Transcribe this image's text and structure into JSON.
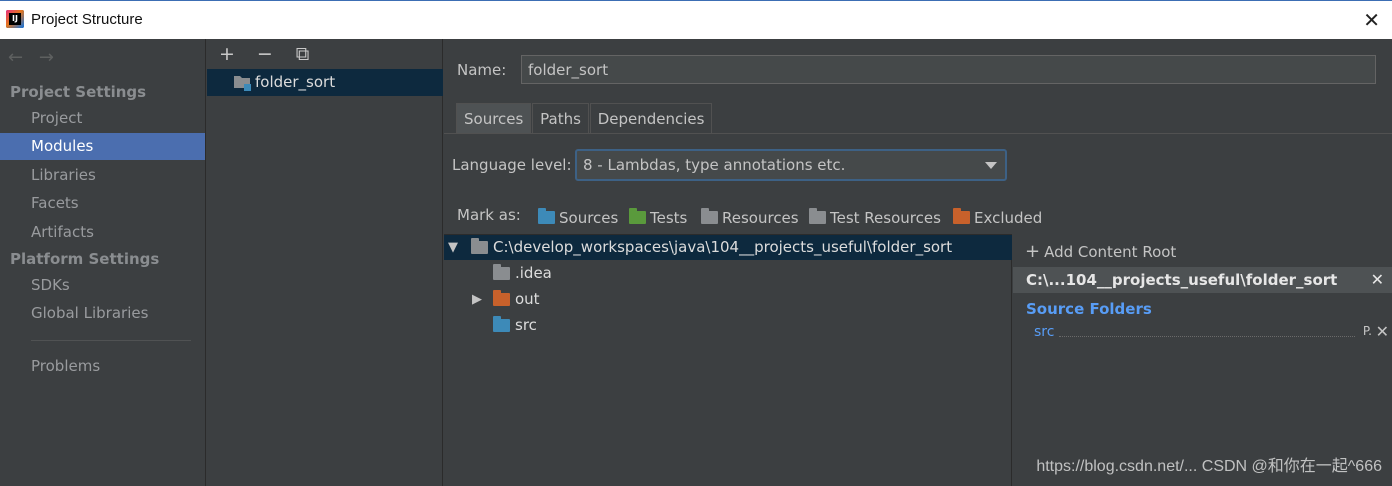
{
  "window": {
    "title": "Project Structure",
    "close_glyph": "✕"
  },
  "nav": {
    "back_glyph": "←",
    "forward_glyph": "→",
    "project_settings_header": "Project Settings",
    "project_settings_items": [
      "Project",
      "Modules",
      "Libraries",
      "Facets",
      "Artifacts"
    ],
    "selected": "Modules",
    "platform_settings_header": "Platform Settings",
    "platform_settings_items": [
      "SDKs",
      "Global Libraries"
    ],
    "problems": "Problems"
  },
  "modules": {
    "toolbar": {
      "add": "+",
      "remove": "−",
      "copy": "⧉"
    },
    "items": [
      "folder_sort"
    ]
  },
  "module": {
    "name_label": "Name:",
    "name_value": "folder_sort",
    "tabs": [
      "Sources",
      "Paths",
      "Dependencies"
    ],
    "active_tab": "Sources",
    "language_level_label": "Language level:",
    "language_level_value": "8 - Lambdas, type annotations etc.",
    "mark_as_label": "Mark as:",
    "mark_as": [
      {
        "label": "Sources",
        "color": "#3d8ab8"
      },
      {
        "label": "Tests",
        "color": "#5a9a3c"
      },
      {
        "label": "Resources",
        "color": "#8a8d90"
      },
      {
        "label": "Test Resources",
        "color": "#8a8d90"
      },
      {
        "label": "Excluded",
        "color": "#c8612b"
      }
    ]
  },
  "tree": {
    "root": "C:\\develop_workspaces\\java\\104__projects_useful\\folder_sort",
    "children": [
      {
        "label": ".idea",
        "color": "#8a8d90",
        "expandable": false
      },
      {
        "label": "out",
        "color": "#c8612b",
        "expandable": true
      },
      {
        "label": "src",
        "color": "#3d8ab8",
        "expandable": false
      }
    ]
  },
  "content_root": {
    "add_label": "Add Content Root",
    "path": "C:\\...104__projects_useful\\folder_sort",
    "source_folders_title": "Source Folders",
    "source_folders": [
      "src"
    ],
    "prop_glyph": "P.",
    "remove_glyph": "✕"
  },
  "watermark": "https://blog.csdn.net/...  CSDN @和你在一起^666"
}
